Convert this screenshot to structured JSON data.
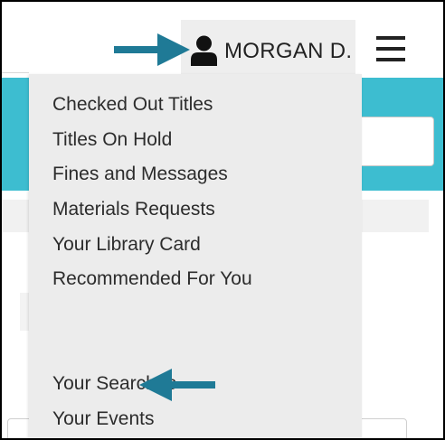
{
  "header": {
    "user_name": "MORGAN D.",
    "user_icon": "user-icon",
    "menu_icon": "hamburger-menu-icon"
  },
  "dropdown": {
    "items": [
      {
        "label": "Checked Out Titles"
      },
      {
        "label": "Titles On Hold"
      },
      {
        "label": "Fines and Messages"
      },
      {
        "label": "Materials Requests"
      },
      {
        "label": "Your Library Card"
      },
      {
        "label": "Recommended For You"
      },
      {
        "label": "Your Searches"
      },
      {
        "label": "Your Events"
      }
    ]
  },
  "annotations": {
    "arrow_color": "#1f7a96"
  },
  "colors": {
    "accent_teal": "#3dbdd0",
    "menu_background": "#ececec",
    "user_button_background": "#eeeeee",
    "text": "#2c2c2c"
  }
}
